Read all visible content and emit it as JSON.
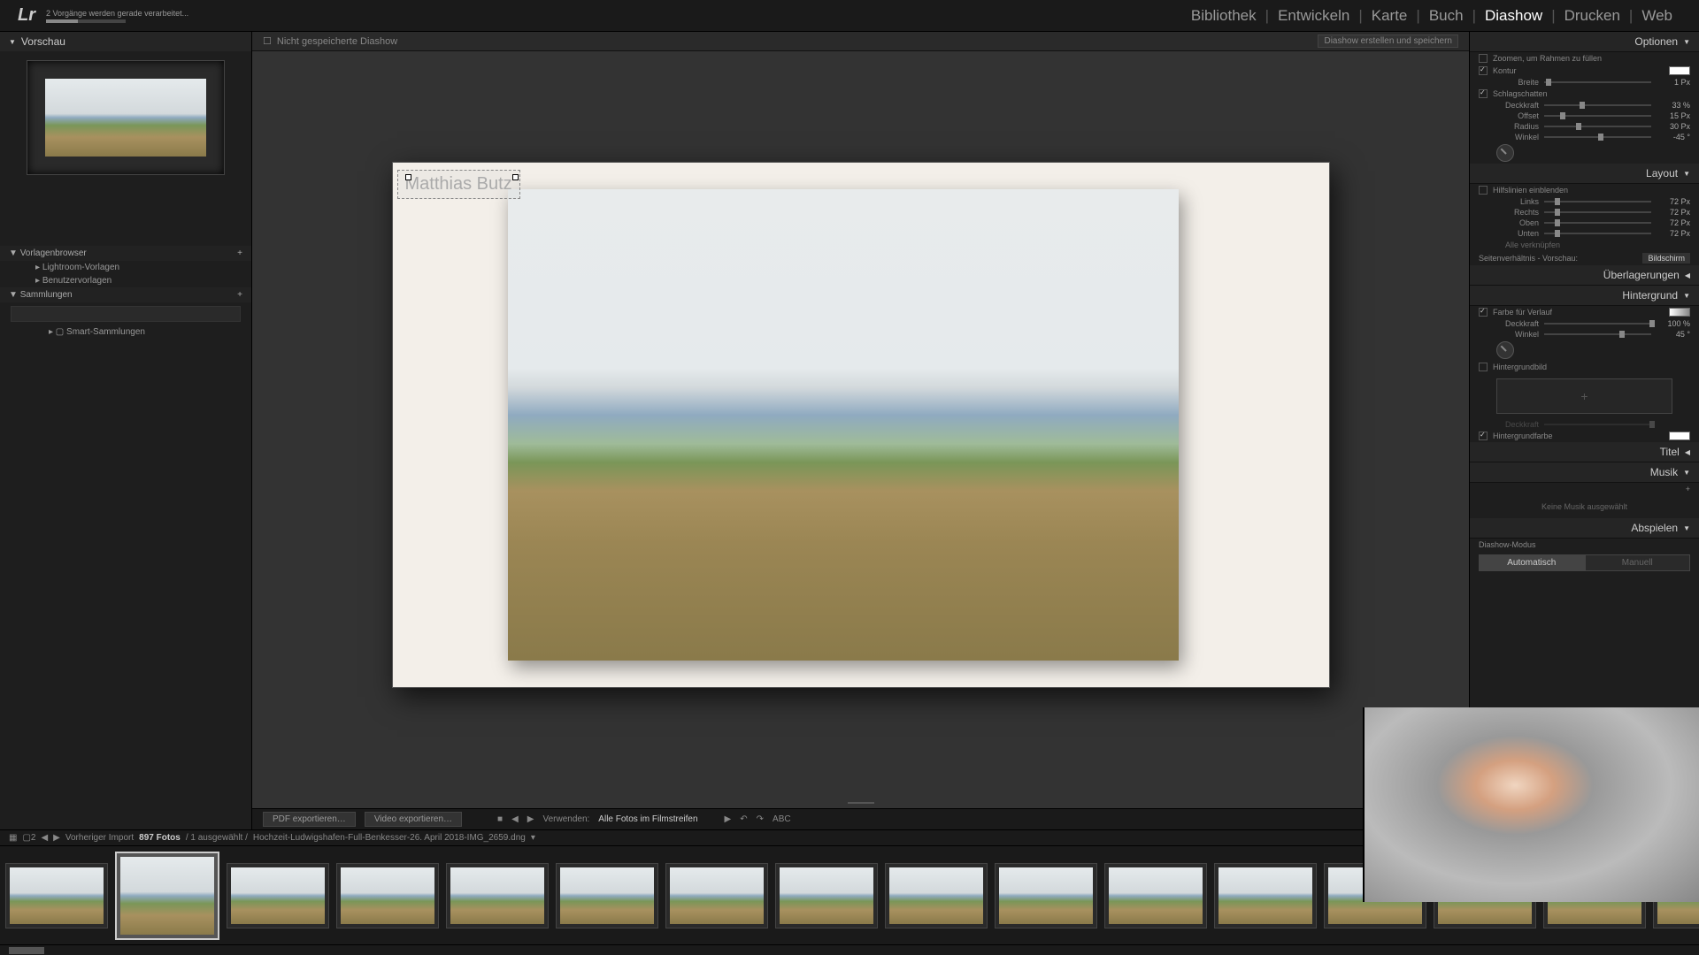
{
  "topbar": {
    "logo": "Lr",
    "progress_text": "2 Vorgänge werden gerade verarbeitet...",
    "nav": [
      "Bibliothek",
      "Entwickeln",
      "Karte",
      "Buch",
      "Diashow",
      "Drucken",
      "Web"
    ],
    "active_nav": "Diashow"
  },
  "left_panel": {
    "preview_header": "Vorschau",
    "template_browser": "Vorlagenbrowser",
    "lightroom_templates": "Lightroom-Vorlagen",
    "user_templates": "Benutzervorlagen",
    "collections": "Sammlungen",
    "smart_collections": "Smart-Sammlungen"
  },
  "center": {
    "title": "Nicht gespeicherte Diashow",
    "save_button": "Diashow erstellen und speichern",
    "overlay_text": "Matthias Butz"
  },
  "right_panel": {
    "options_header": "Optionen",
    "zoom_fill": "Zoomen, um Rahmen zu füllen",
    "contour": "Kontur",
    "width": "Breite",
    "width_val": "1 Px",
    "shadow": "Schlagschatten",
    "opacity": "Deckkraft",
    "opacity_val": "33 %",
    "offset": "Offset",
    "offset_val": "15 Px",
    "radius": "Radius",
    "radius_val": "30 Px",
    "angle": "Winkel",
    "angle_val": "-45 °",
    "layout_header": "Layout",
    "show_guides": "Hilfslinien einblenden",
    "left": "Links",
    "right": "Rechts",
    "top": "Oben",
    "bottom": "Unten",
    "guide_val": "72 Px",
    "link_all": "Alle verknüpfen",
    "aspect_ratio": "Seitenverhältnis - Vorschau:",
    "aspect_val": "Bildschirm",
    "overlays_header": "Überlagerungen",
    "background_header": "Hintergrund",
    "gradient": "Farbe für Verlauf",
    "bg_opacity_val": "100 %",
    "bg_angle_val": "45 °",
    "bg_image": "Hintergrundbild",
    "bg_image_opacity": "Deckkraft",
    "bg_color": "Hintergrundfarbe",
    "title_header": "Titel",
    "music_header": "Musik",
    "no_music": "Keine Musik ausgewählt",
    "playback_header": "Abspielen",
    "slideshow_mode": "Diashow-Modus",
    "mode_auto": "Automatisch",
    "mode_manual": "Manuell"
  },
  "toolbar": {
    "pdf_export": "PDF exportieren…",
    "video_export": "Video exportieren…",
    "use_label": "Verwenden:",
    "use_value": "Alle Fotos im Filmstreifen",
    "abc": "ABC"
  },
  "info_bar": {
    "prev_import": "Vorheriger Import",
    "photo_count": "897 Fotos",
    "selected": " / 1 ausgewählt / ",
    "filename": "Hochzeit-Ludwigshafen-Full-Benkesser-26. April 2018-IMG_2659.dng"
  }
}
